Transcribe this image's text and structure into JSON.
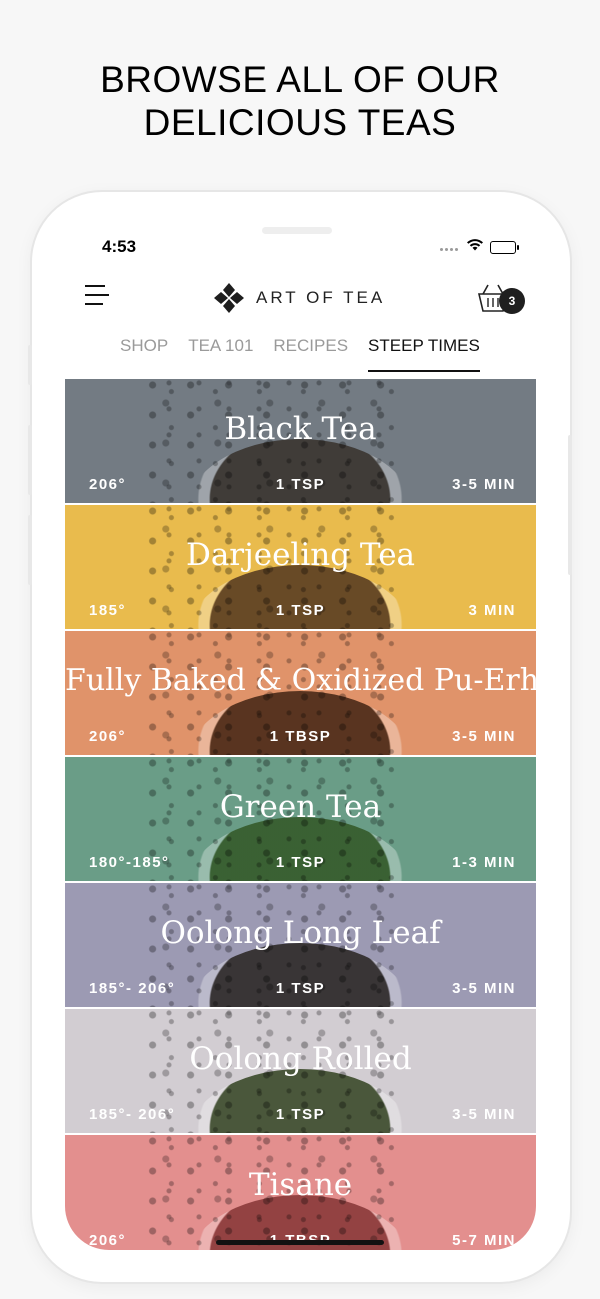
{
  "headline": {
    "line1": "BROWSE ALL OF OUR",
    "line2": "DELICIOUS TEAS"
  },
  "status_bar": {
    "time": "4:53"
  },
  "header": {
    "brand": "ART OF TEA",
    "cart_count": "3"
  },
  "tabs": [
    {
      "label": "SHOP",
      "active": false
    },
    {
      "label": "TEA 101",
      "active": false
    },
    {
      "label": "RECIPES",
      "active": false
    },
    {
      "label": "STEEP TIMES",
      "active": true
    }
  ],
  "teas": [
    {
      "name": "Black Tea",
      "temp": "206°",
      "amount": "1 TSP",
      "time": "3-5 MIN",
      "color": "#737b83",
      "bowl": "#3a3530"
    },
    {
      "name": "Darjeeling Tea",
      "temp": "185°",
      "amount": "1 TSP",
      "time": "3 MIN",
      "color": "#e9bb4d",
      "bowl": "#5a3d22"
    },
    {
      "name": "Fully Baked & Oxidized Pu-Erh",
      "temp": "206°",
      "amount": "1 TBSP",
      "time": "3-5 MIN",
      "color": "#e0936a",
      "bowl": "#4a2a18"
    },
    {
      "name": "Green Tea",
      "temp": "180°-185°",
      "amount": "1 TSP",
      "time": "1-3 MIN",
      "color": "#6a9d87",
      "bowl": "#355a2a"
    },
    {
      "name": "Oolong Long Leaf",
      "temp": "185°- 206°",
      "amount": "1 TSP",
      "time": "3-5 MIN",
      "color": "#9c9ab3",
      "bowl": "#2e2a28"
    },
    {
      "name": "Oolong Rolled",
      "temp": "185°- 206°",
      "amount": "1 TSP",
      "time": "3-5 MIN",
      "color": "#d2cdd2",
      "bowl": "#3b4a2a"
    },
    {
      "name": "Tisane",
      "temp": "206°",
      "amount": "1 TBSP",
      "time": "5-7 MIN",
      "color": "#e38f8e",
      "bowl": "#8a3a3a"
    }
  ]
}
